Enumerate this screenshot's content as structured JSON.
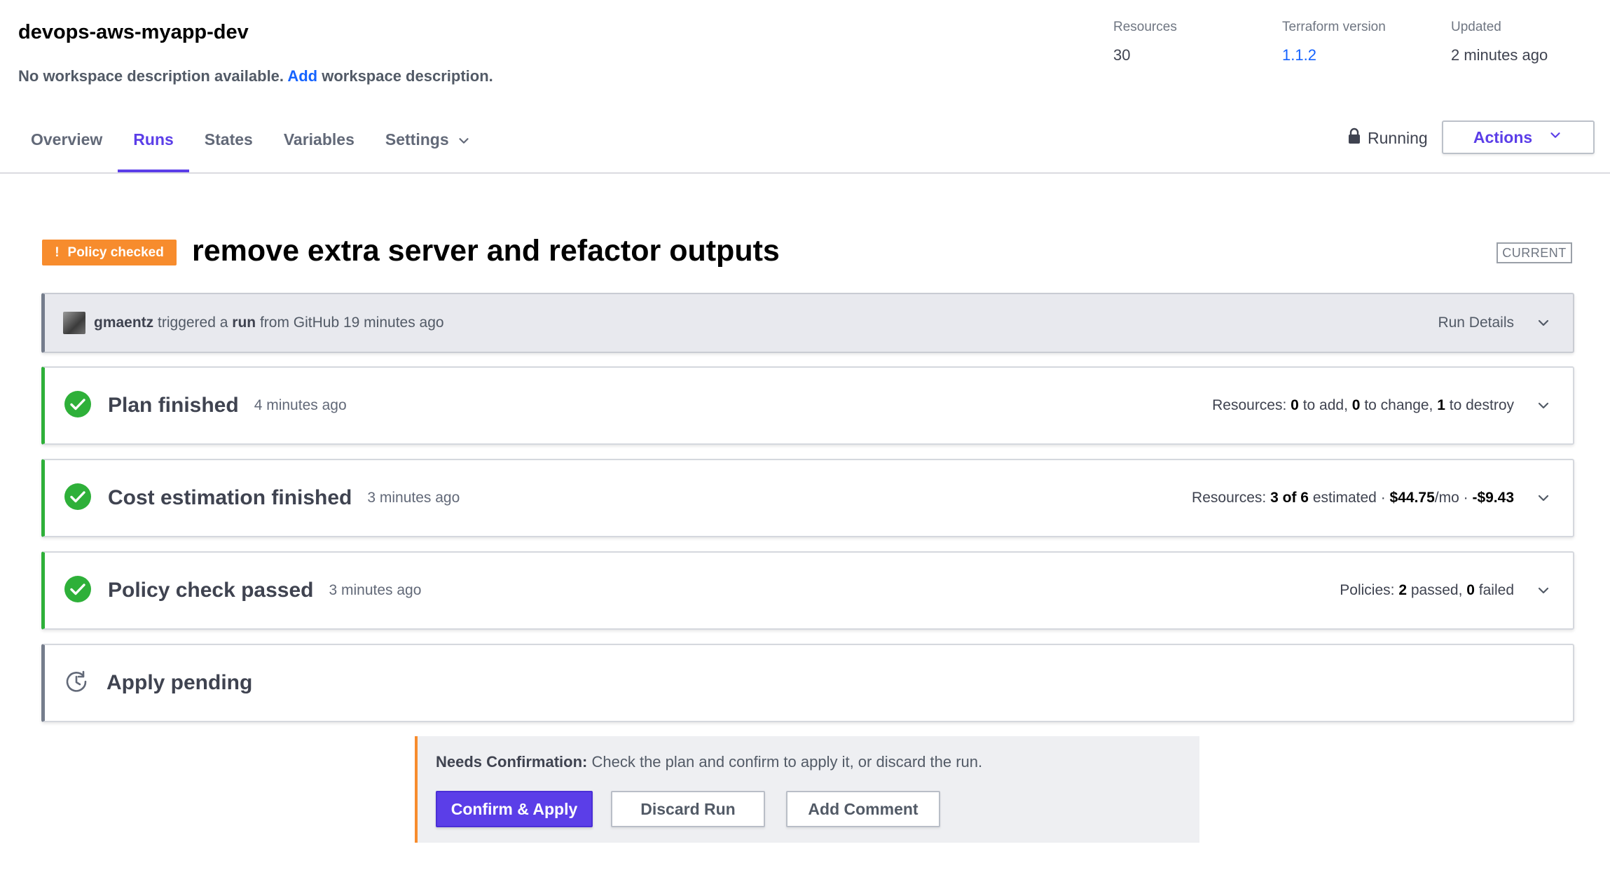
{
  "workspace": {
    "name": "devops-aws-myapp-dev",
    "description_prefix": "No workspace description available.",
    "description_link": "Add",
    "description_suffix": "workspace description."
  },
  "meta": {
    "resources_label": "Resources",
    "resources_value": "30",
    "terraform_label": "Terraform version",
    "terraform_value": "1.1.2",
    "updated_label": "Updated",
    "updated_value": "2 minutes ago"
  },
  "tabs": [
    {
      "label": "Overview"
    },
    {
      "label": "Runs"
    },
    {
      "label": "States"
    },
    {
      "label": "Variables"
    },
    {
      "label": "Settings"
    }
  ],
  "active_tab": "Runs",
  "status": {
    "lock_label": "Running",
    "actions_label": "Actions"
  },
  "run": {
    "badge": "Policy checked",
    "badge_icon": "!",
    "title": "remove extra server and refactor outputs",
    "current_badge": "CURRENT"
  },
  "trigger": {
    "user": "gmaentz",
    "text1": "triggered a",
    "run_word": "run",
    "text2": "from GitHub 19 minutes ago",
    "details_label": "Run Details"
  },
  "stages": {
    "plan": {
      "title": "Plan finished",
      "time": "4 minutes ago",
      "label": "Resources:",
      "add": "0",
      "add_text": "to add,",
      "change": "0",
      "change_text": "to change,",
      "destroy": "1",
      "destroy_text": "to destroy"
    },
    "cost": {
      "title": "Cost estimation finished",
      "time": "3 minutes ago",
      "label": "Resources:",
      "estimated": "3 of 6",
      "estimated_text": "estimated ·",
      "monthly": "$44.75",
      "monthly_unit": "/mo ·",
      "delta": "-$9.43"
    },
    "policy": {
      "title": "Policy check passed",
      "time": "3 minutes ago",
      "label": "Policies:",
      "passed": "2",
      "passed_text": "passed,",
      "failed": "0",
      "failed_text": "failed"
    },
    "apply": {
      "title": "Apply pending"
    }
  },
  "confirmation": {
    "heading": "Needs Confirmation:",
    "message": "Check the plan and confirm to apply it, or discard the run.",
    "confirm_label": "Confirm & Apply",
    "discard_label": "Discard Run",
    "comment_label": "Add Comment"
  },
  "colors": {
    "accent": "#5b3ee8",
    "link": "#1563ff",
    "warning": "#f78c2d",
    "success": "#2eb039"
  }
}
